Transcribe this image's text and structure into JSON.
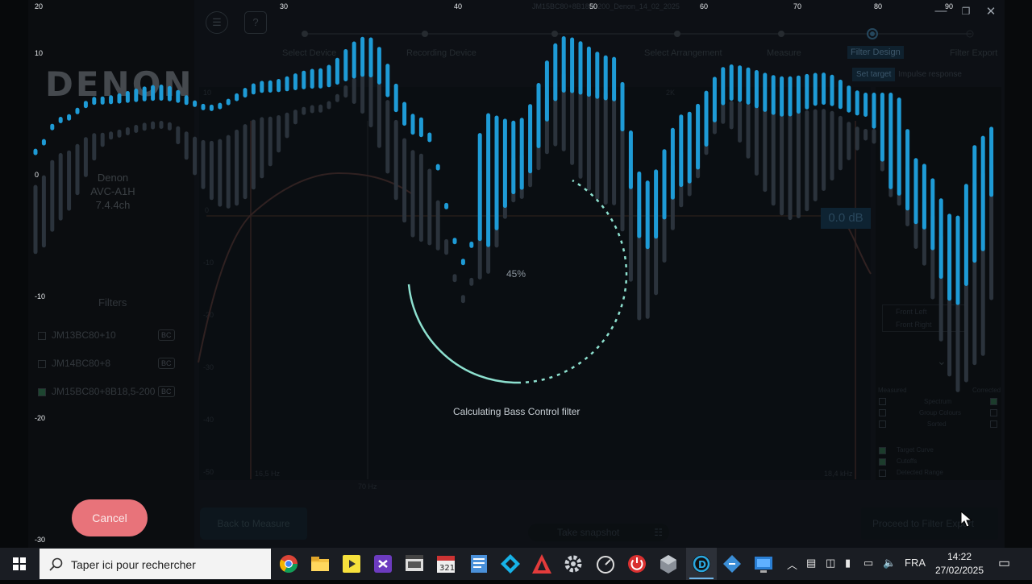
{
  "window": {
    "file_title": "JM15BC80+8B18,5-200_Denon_14_02_2025",
    "minimize_label": "—",
    "maximize_label": "❐",
    "close_label": "✕"
  },
  "sidebar": {
    "logo": "DENON",
    "device_name": "Denon",
    "device_model": "AVC-A1H",
    "device_channels": "7.4.4ch",
    "filters_title": "Filters",
    "filters": [
      {
        "label": "JM13BC80+10",
        "badge": "BC",
        "checked": false
      },
      {
        "label": "JM14BC80+8",
        "badge": "BC",
        "checked": false
      },
      {
        "label": "JM15BC80+8B18,5-200",
        "badge": "BC",
        "checked": true
      }
    ],
    "cancel_label": "Cancel"
  },
  "header": {
    "menu_icon": "hamburger-icon",
    "help_label": "?",
    "steps": [
      "Select Device",
      "Recording Device",
      "Select Arrangement",
      "Measure",
      "Filter Design",
      "Filter Export"
    ],
    "active_step": "Filter Design",
    "subtabs": [
      "Set target",
      "Impulse response"
    ]
  },
  "graph": {
    "outer_y_ticks": [
      "20",
      "10",
      "0",
      "-10",
      "-20",
      "-30"
    ],
    "outer_x_ticks": [
      "30",
      "40",
      "50",
      "60",
      "70",
      "80",
      "90"
    ],
    "inner_y_ticks": [
      "10",
      "0",
      "-10",
      "-20",
      "-30",
      "-40",
      "-50"
    ],
    "inner_x_labels": {
      "left_freq": "16,5 Hz",
      "mid_freq": "70 Hz",
      "right_freq": "18,4 kHz",
      "top_freq": "2K"
    },
    "db_tag": "0.0 dB",
    "progress_text": "45%",
    "progress_value": 0.45,
    "status": "Calculating Bass Control filter"
  },
  "right_panel": {
    "channels": [
      "Front Left",
      "Front Right"
    ],
    "options_measured": "Measured",
    "options_corrected": "Corrected",
    "rows": [
      "Spectrum",
      "Group Colours",
      "Sorted"
    ],
    "lower_rows": [
      "Target Curve",
      "Cutoffs",
      "Detected Range"
    ]
  },
  "footer": {
    "back_label": "Back to Measure",
    "snapshot_label": "Take snapshot",
    "proceed_label": "Proceed to Filter Export"
  },
  "taskbar": {
    "search_placeholder": "Taper ici pour rechercher",
    "language": "FRA",
    "time": "14:22",
    "date": "27/02/2025",
    "icons": [
      "chrome-icon",
      "file-explorer-icon",
      "player-icon",
      "visual-studio-icon",
      "mpc-hc-icon",
      "calendar-321-icon",
      "notepad-icon",
      "kodi-icon",
      "red-a-icon",
      "settings-gear-icon",
      "speedometer-icon",
      "power-icon",
      "cube-icon",
      "dirac-icon",
      "blue-arrow-icon",
      "monitor-app-icon"
    ]
  },
  "colors": {
    "bar_blue": "#1e9bd6",
    "bar_grey": "#2b333c",
    "spinner": "#8de0cf",
    "cancel": "#e8737a"
  }
}
